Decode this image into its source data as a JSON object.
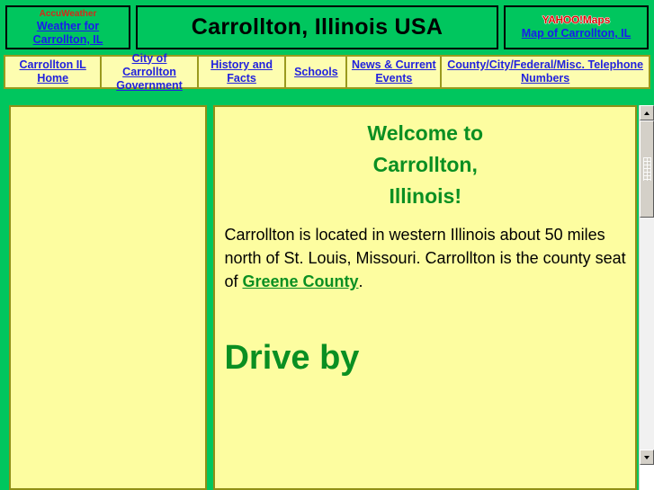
{
  "header": {
    "weather_box": {
      "provider": "AccuWeather",
      "link_label": "Weather for\nCarrollton, IL"
    },
    "title": "Carrollton, Illinois USA",
    "maps_box": {
      "logo_yahoo": "YAHOO!",
      "logo_maps": "Maps",
      "link_label": "Map of Carrollton, IL"
    }
  },
  "nav": {
    "items": [
      {
        "label": "Carrollton IL Home"
      },
      {
        "label": "City of Carrollton\nGovernment"
      },
      {
        "label": "History and Facts"
      },
      {
        "label": "Schools"
      },
      {
        "label": "News & Current\nEvents"
      },
      {
        "label": "County/City/Federal/Misc.\nTelephone Numbers"
      }
    ]
  },
  "main": {
    "left_panel": {
      "content": ""
    },
    "right_panel": {
      "heading": "Welcome to\nCarrollton,\nIllinois!",
      "body_before_link": "Carrollton is located in western Illinois about 50 miles north of St. Louis, Missouri.  Carrollton is the county seat of ",
      "link_label": "Greene County",
      "body_after_link": ".",
      "drive_by": "Drive by"
    }
  },
  "colors": {
    "page_background": "#00c65e",
    "panel_background": "#fdfda0",
    "panel_border": "#8f8f16",
    "nav_background": "#fdfdb0",
    "nav_border": "#9a9a1e",
    "link_blue": "#2222dd",
    "heading_green": "#0a8f22",
    "accuweather_red": "#d42a18",
    "yahoo_red": "#e00a0a"
  },
  "scrollbar": {
    "up_arrow": "scroll-up-arrow",
    "down_arrow": "scroll-down-arrow",
    "thumb": "scroll-thumb"
  }
}
